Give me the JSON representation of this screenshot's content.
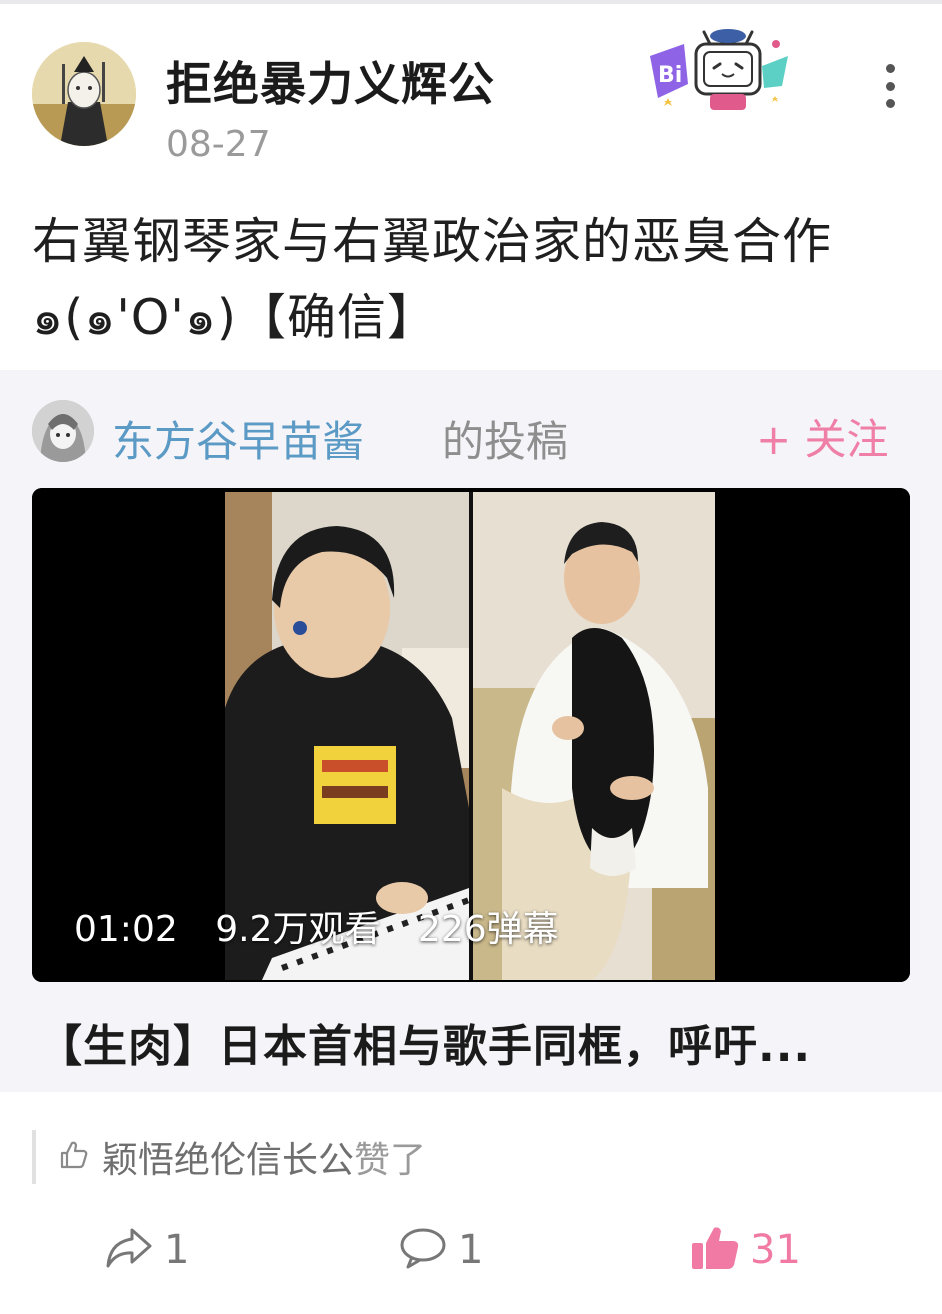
{
  "post": {
    "username": "拒绝暴力义辉公",
    "date": "08-27",
    "text": "右翼钢琴家与右翼政治家的恶臭合作๑(๑'O'๑)【确信】"
  },
  "repost": {
    "uploader": "东方谷早苗酱",
    "uploader_suffix": "的投稿",
    "follow_label": "+ 关注",
    "video": {
      "duration": "01:02",
      "views": "9.2万观看",
      "danmaku": "226弹幕"
    },
    "title": "【生肉】日本首相与歌手同框，呼吁..."
  },
  "likes": {
    "names": "颖悟绝伦信长公",
    "suffix": "赞了"
  },
  "actions": {
    "share_count": "1",
    "comment_count": "1",
    "like_count": "31"
  },
  "icons": {
    "more": "more-vertical-icon",
    "thumb_small": "thumbs-up-outline-icon",
    "share": "share-arrow-icon",
    "comment": "comment-bubble-icon",
    "like": "thumbs-up-filled-icon"
  },
  "colors": {
    "accent_pink": "#f07aa3",
    "link_blue": "#5b9ac5",
    "card_bg": "#f5f4f8"
  }
}
